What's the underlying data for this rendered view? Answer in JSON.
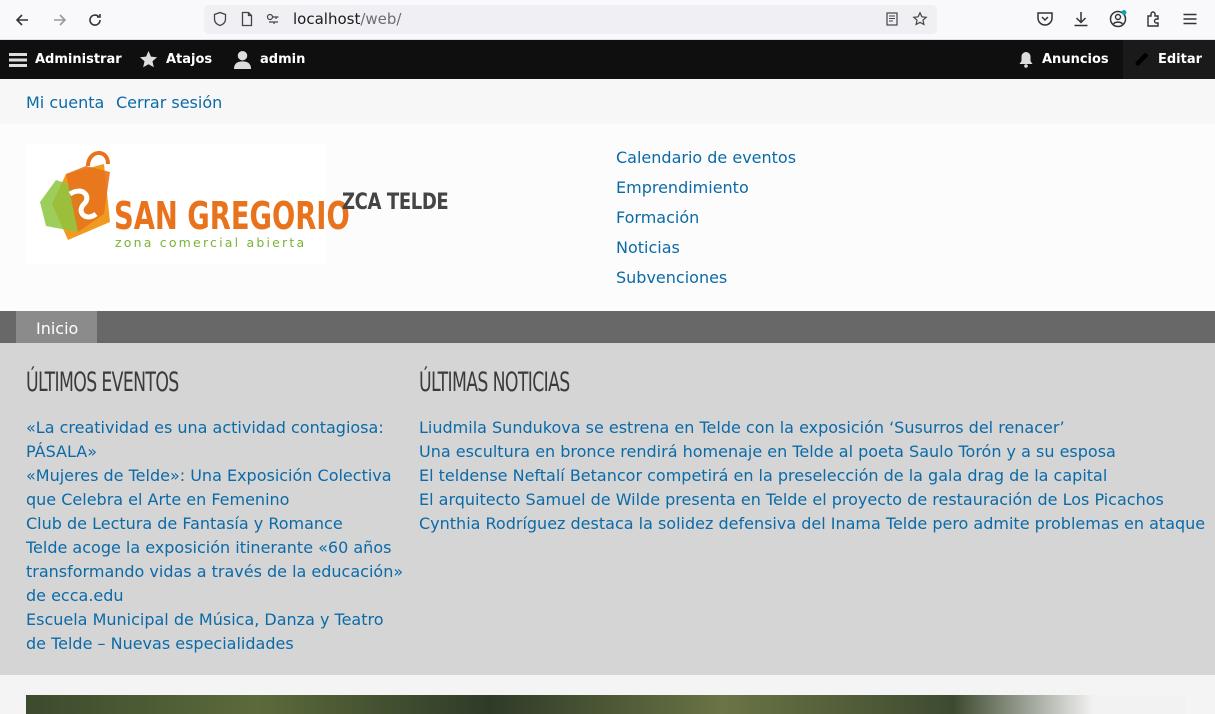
{
  "browser": {
    "url_host": "localhost",
    "url_path": "/web/"
  },
  "toolbar": {
    "manage": "Administrar",
    "shortcuts": "Atajos",
    "user": "admin",
    "announcements": "Anuncios",
    "edit": "Editar"
  },
  "secondary_menu": {
    "account": "Mi cuenta",
    "logout": "Cerrar sesión"
  },
  "header": {
    "logo_text": "SAN GREGORIO",
    "logo_tagline": "zona comercial abierta",
    "site_name": "ZCA TELDE",
    "menu": [
      "Calendario de eventos",
      "Emprendimiento",
      "Formación",
      "Noticias",
      "Subvenciones"
    ]
  },
  "tabs": {
    "home": "Inicio"
  },
  "events": {
    "title": "ÚLTIMOS EVENTOS",
    "items": [
      "«La creatividad es una actividad contagiosa: PÁSALA»",
      "«Mujeres de Telde»: Una Exposición Colectiva que Celebra el Arte en Femenino",
      "Club de Lectura de Fantasía y Romance",
      "Telde acoge la exposición itinerante «60 años transformando vidas a través de la educación» de ecca.edu",
      "Escuela Municipal de Música, Danza y Teatro de Telde – Nuevas especialidades"
    ]
  },
  "news": {
    "title": "ÚLTIMAS NOTICIAS",
    "items": [
      "Liudmila Sundukova se estrena en Telde con la exposición ‘Susurros del renacer’",
      "Una escultura en bronce rendirá homenaje en Telde al poeta Saulo Torón y a su esposa",
      "El teldense Neftalí Betancor competirá en la preselección de la gala drag de la capital",
      "El arquitecto Samuel de Wilde presenta en Telde el proyecto de restauración de Los Picachos",
      "Cynthia Rodríguez destaca la solidez defensiva del Inama Telde pero admite problemas en ataque"
    ]
  },
  "colors": {
    "link": "#0b6aa8",
    "toolbar_bg": "#0f0f0f",
    "content_bg": "#d5d5d5",
    "tabbar_bg": "#686868",
    "logo_orange": "#e8731c",
    "logo_green": "#8cc63f"
  }
}
